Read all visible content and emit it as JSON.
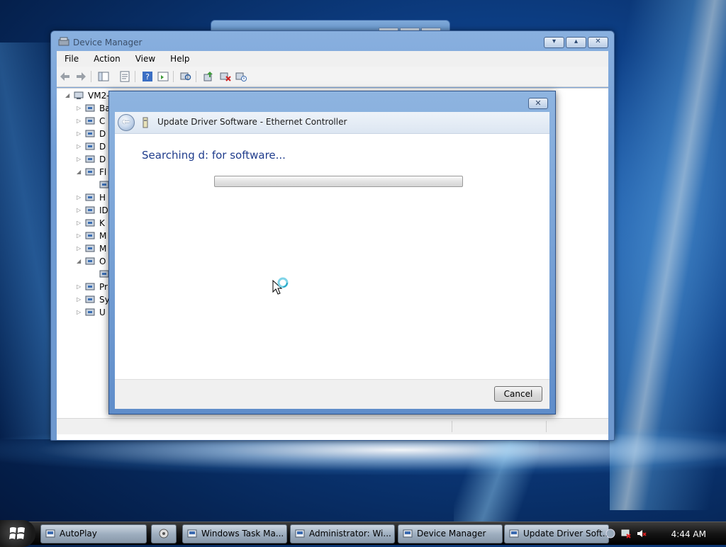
{
  "device_manager": {
    "title": "Device Manager",
    "menu": [
      "File",
      "Action",
      "View",
      "Help"
    ],
    "tree": {
      "root": "VM2-",
      "items": [
        {
          "label": "Ba",
          "icon": "battery-icon",
          "expanded": false
        },
        {
          "label": "C",
          "icon": "computer-icon",
          "expanded": false
        },
        {
          "label": "D",
          "icon": "disk-drive-icon",
          "expanded": false
        },
        {
          "label": "D",
          "icon": "display-adapter-icon",
          "expanded": false
        },
        {
          "label": "D",
          "icon": "dvd-drive-icon",
          "expanded": false
        },
        {
          "label": "Fl",
          "icon": "floppy-controller-icon",
          "expanded": true
        },
        {
          "label": "",
          "icon": "floppy-drive-icon",
          "expanded": false,
          "child": true
        },
        {
          "label": "H",
          "icon": "human-interface-icon",
          "expanded": false
        },
        {
          "label": "ID",
          "icon": "ide-controller-icon",
          "expanded": false
        },
        {
          "label": "K",
          "icon": "keyboard-icon",
          "expanded": false
        },
        {
          "label": "M",
          "icon": "mouse-icon",
          "expanded": false
        },
        {
          "label": "M",
          "icon": "monitor-icon",
          "expanded": false
        },
        {
          "label": "O",
          "icon": "other-devices-icon",
          "expanded": true
        },
        {
          "label": "",
          "icon": "unknown-device-icon",
          "expanded": false,
          "child": true
        },
        {
          "label": "Pr",
          "icon": "processor-icon",
          "expanded": false
        },
        {
          "label": "Sy",
          "icon": "system-devices-icon",
          "expanded": false
        },
        {
          "label": "U",
          "icon": "usb-controller-icon",
          "expanded": false
        }
      ]
    }
  },
  "dialog": {
    "title": "Update Driver Software - Ethernet Controller",
    "status_text": "Searching d: for software...",
    "progress": 0.0,
    "cancel_label": "Cancel"
  },
  "taskbar": {
    "buttons": [
      {
        "label": "AutoPlay",
        "icon": "autoplay-icon"
      },
      {
        "label": "Windows Task Ma...",
        "icon": "task-manager-icon"
      },
      {
        "label": "Administrator:  Wi...",
        "icon": "command-prompt-icon"
      },
      {
        "label": "Device Manager",
        "icon": "device-manager-icon"
      },
      {
        "label": "Update Driver Soft...",
        "icon": "update-driver-icon"
      }
    ],
    "clock": "4:44 AM"
  },
  "colors": {
    "accent_text": "#1f3c8c",
    "window_frame": "#6f9bd3",
    "taskbar": "#151515"
  }
}
